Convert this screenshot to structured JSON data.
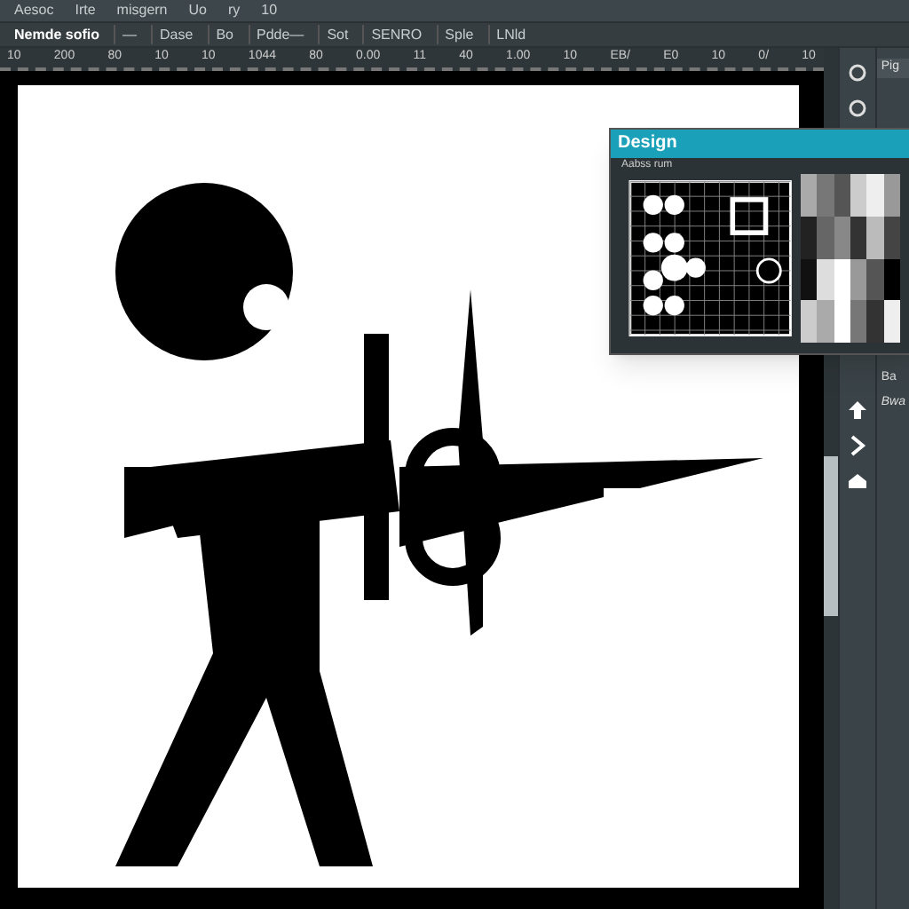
{
  "menu": [
    "Aesoc",
    "Irte",
    "misgern",
    "Uo",
    "ry",
    "10"
  ],
  "toolbar": [
    "Nemde sofio",
    "—",
    "Dase",
    "Bo",
    "Pdde—",
    "Sot",
    "SENRO",
    "Sple",
    "LNld"
  ],
  "ruler": [
    "10",
    "200",
    "80",
    "10",
    "10",
    "1044",
    "80",
    "0.00",
    "11",
    "40",
    "1.00",
    "10",
    "EB/",
    "E0",
    "10",
    "0/",
    "10"
  ],
  "design_panel": {
    "title": "Design",
    "subtitle": "Aabss rum"
  },
  "side_panel": {
    "tab": "Pig",
    "rows": [
      "Ba",
      "Bwa"
    ]
  }
}
